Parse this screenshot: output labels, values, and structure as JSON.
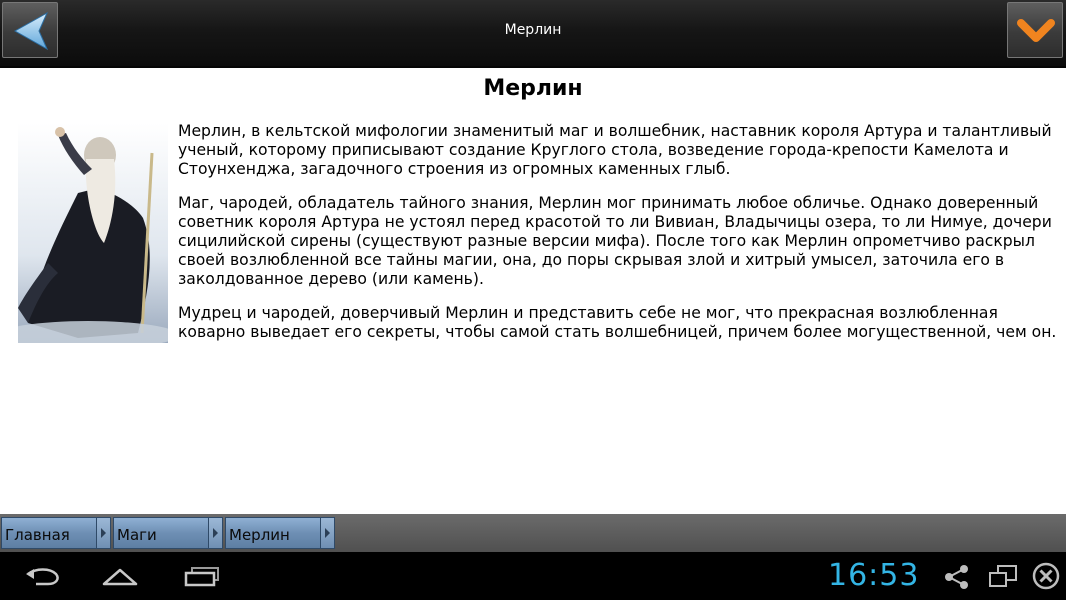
{
  "topbar": {
    "title": "Мерлин",
    "back_icon": "back-arrow-icon",
    "confirm_icon": "chevron-down-icon",
    "accent": "#f0841f"
  },
  "article": {
    "title": "Мерлин",
    "image_icon": "merlin-portrait",
    "paragraphs": [
      "Мерлин, в кельтской мифологии знаменитый маг и волшебник, наставник короля Артура и талантливый ученый, которому приписывают создание Круглого стола, возведение города-крепости Камелота и Стоунхенджа, загадочного строения из огромных каменных глыб.",
      "Маг, чародей, обладатель тайного знания, Мерлин мог принимать любое обличье. Однако доверенный советник короля Артура не устоял перед красотой то ли Вивиан, Владычицы озера, то ли Нимуе, дочери сицилийской сирены (существуют разные версии мифа). После того как Мерлин опрометчиво раскрыл своей возлюбленной все тайны магии, она, до поры скрывая злой и хитрый умысел, заточила его в заколдованное дерево (или камень).",
      "Мудрец и чародей, доверчивый Мерлин и представить себе не мог, что прекрасная возлюбленная коварно выведает его секреты, чтобы самой стать волшебницей, причем более могущественной, чем он."
    ]
  },
  "breadcrumbs": [
    {
      "label": "Главная"
    },
    {
      "label": "Маги"
    },
    {
      "label": "Мерлин"
    }
  ],
  "navbar": {
    "clock": "16:53",
    "clock_color": "#33b5e5",
    "icons": [
      "back-icon",
      "home-icon",
      "recent-apps-icon",
      "share-icon",
      "screen-mirror-icon",
      "close-icon"
    ]
  }
}
